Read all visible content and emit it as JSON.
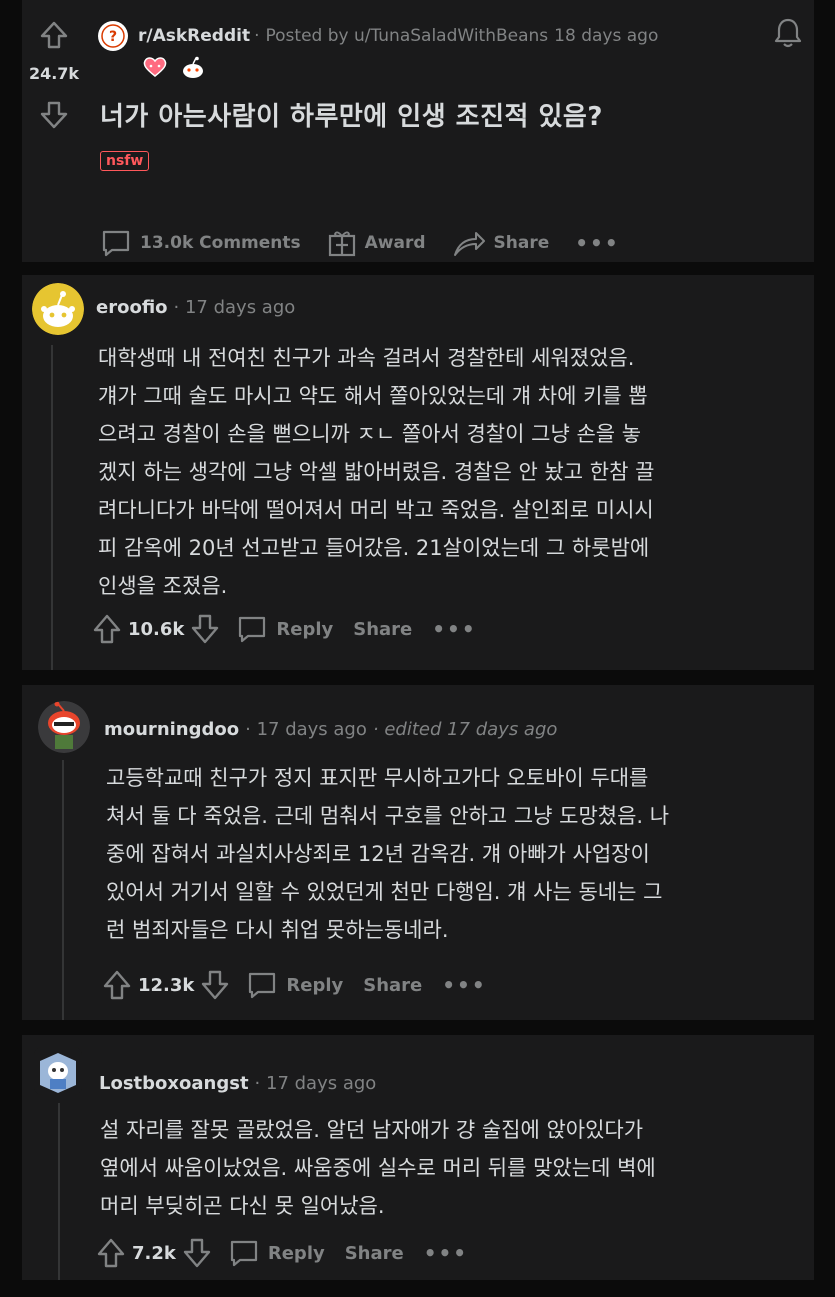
{
  "post": {
    "subreddit": "r/AskReddit",
    "posted_by": "Posted by u/TunaSaladWithBeans",
    "age": "18 days ago",
    "score": "24.7k",
    "title": "너가 아는사람이 하루만에 인생 조진적 있음?",
    "tag": "nsfw",
    "comments_label": "13.0k Comments",
    "award_label": "Award",
    "share_label": "Share",
    "more": "•••"
  },
  "comments": [
    {
      "user": "eroofio",
      "age": "· 17 days ago",
      "edited": "",
      "body": "대학생때 내 전여친 친구가 과속 걸려서 경찰한테 세워졌었음.\n걔가 그때 술도 마시고 약도 해서 쫄아있었는데 걔 차에 키를 뽑\n으려고 경찰이 손을 뻗으니까 ㅈㄴ 쫄아서 경찰이 그냥 손을 놓\n겠지 하는 생각에 그냥 악셀 밟아버렸음. 경찰은 안 놨고 한참 끌\n려다니다가 바닥에 떨어져서 머리 박고 죽었음. 살인죄로 미시시\n피 감옥에 20년 선고받고 들어갔음. 21살이었는데 그 하룻밤에\n인생을 조졌음.",
      "score": "10.6k",
      "reply": "Reply",
      "share": "Share",
      "more": "•••"
    },
    {
      "user": "mourningdoo",
      "age": "· 17 days ago",
      "edited": "· edited 17 days ago",
      "body": "고등학교때 친구가 정지 표지판 무시하고가다 오토바이 두대를\n쳐서 둘 다 죽었음. 근데 멈춰서 구호를 안하고 그냥 도망쳤음. 나\n중에 잡혀서 과실치사상죄로 12년 감옥감. 걔 아빠가 사업장이\n있어서 거기서 일할 수 있었던게 천만 다행임. 걔 사는 동네는 그\n런 범죄자들은 다시 취업 못하는동네라.",
      "score": "12.3k",
      "reply": "Reply",
      "share": "Share",
      "more": "•••"
    },
    {
      "user": "Lostboxoangst",
      "age": "· 17 days ago",
      "edited": "",
      "body": "설 자리를 잘못 골랐었음. 알던 남자애가 걍 술집에 앉아있다가\n옆에서 싸움이났었음. 싸움중에 실수로 머리 뒤를 맞았는데 벽에\n머리 부딪히곤 다신 못 일어났음.",
      "score": "7.2k",
      "reply": "Reply",
      "share": "Share",
      "more": "•••"
    }
  ],
  "colors": {
    "background": "#0b0b0b",
    "card": "#1a1a1b",
    "text": "#d7dadc",
    "muted": "#818384",
    "nsfw": "#ff585b"
  }
}
